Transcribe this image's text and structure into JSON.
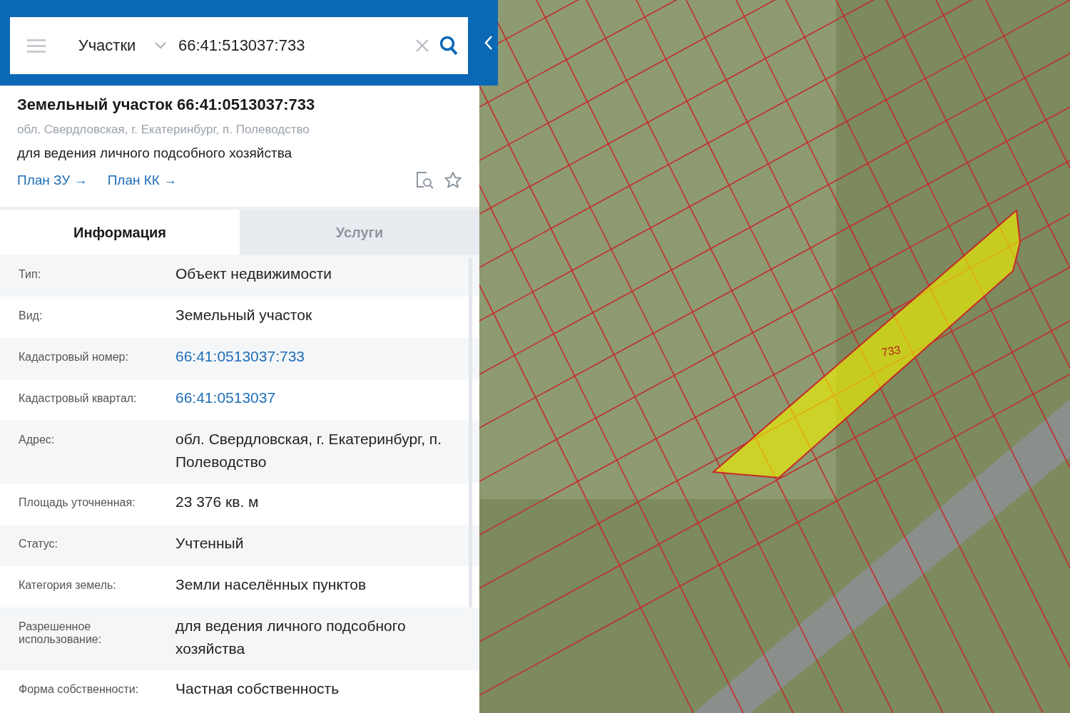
{
  "search": {
    "category": "Участки",
    "value": "66:41:513037:733"
  },
  "object": {
    "title": "Земельный участок 66:41:0513037:733",
    "address": "обл. Свердловская, г. Екатеринбург, п. Полеводство",
    "purpose": "для ведения личного подсобного хозяйства",
    "links": [
      "План ЗУ →",
      "План КК →"
    ]
  },
  "tabs": [
    {
      "label": "Информация",
      "selected": true
    },
    {
      "label": "Услуги",
      "selected": false
    }
  ],
  "rows": [
    {
      "label": "Тип:",
      "value": "Объект недвижимости",
      "kind": "text"
    },
    {
      "label": "Вид:",
      "value": "Земельный участок",
      "kind": "text"
    },
    {
      "label": "Кадастровый номер:",
      "value": "66:41:0513037:733",
      "kind": "link"
    },
    {
      "label": "Кадастровый квартал:",
      "value": "66:41:0513037",
      "kind": "link"
    },
    {
      "label": "Адрес:",
      "value": "обл. Свердловская, г. Екатеринбург, п. Полеводство",
      "kind": "text"
    },
    {
      "label": "Площадь уточненная:",
      "value": "23 376 кв. м",
      "kind": "text"
    },
    {
      "label": "Статус:",
      "value": "Учтенный",
      "kind": "text"
    },
    {
      "label": "Категория земель:",
      "value": "Земли населённых пунктов",
      "kind": "text"
    },
    {
      "label": "Разрешенное использование:",
      "value": "для ведения личного подсобного хозяйства",
      "kind": "text"
    },
    {
      "label": "Форма собственности:",
      "value": "Частная собственность",
      "kind": "text"
    }
  ],
  "map": {
    "selected_parcel_label": "733"
  }
}
